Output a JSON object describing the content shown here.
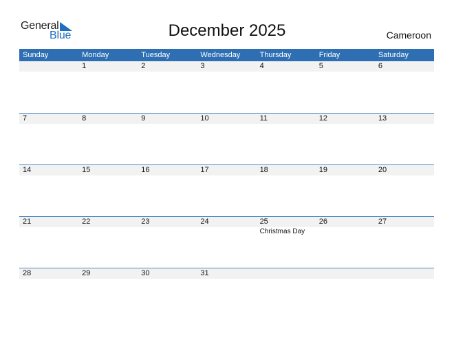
{
  "logo": {
    "general": "General",
    "blue": "Blue",
    "accent_color": "#1f6fc0"
  },
  "title": "December 2025",
  "country": "Cameroon",
  "header_color": "#2e6fb4",
  "weekdays": [
    "Sunday",
    "Monday",
    "Tuesday",
    "Wednesday",
    "Thursday",
    "Friday",
    "Saturday"
  ],
  "weeks": [
    {
      "days": [
        {
          "num": "",
          "event": ""
        },
        {
          "num": "1",
          "event": ""
        },
        {
          "num": "2",
          "event": ""
        },
        {
          "num": "3",
          "event": ""
        },
        {
          "num": "4",
          "event": ""
        },
        {
          "num": "5",
          "event": ""
        },
        {
          "num": "6",
          "event": ""
        }
      ]
    },
    {
      "days": [
        {
          "num": "7",
          "event": ""
        },
        {
          "num": "8",
          "event": ""
        },
        {
          "num": "9",
          "event": ""
        },
        {
          "num": "10",
          "event": ""
        },
        {
          "num": "11",
          "event": ""
        },
        {
          "num": "12",
          "event": ""
        },
        {
          "num": "13",
          "event": ""
        }
      ]
    },
    {
      "days": [
        {
          "num": "14",
          "event": ""
        },
        {
          "num": "15",
          "event": ""
        },
        {
          "num": "16",
          "event": ""
        },
        {
          "num": "17",
          "event": ""
        },
        {
          "num": "18",
          "event": ""
        },
        {
          "num": "19",
          "event": ""
        },
        {
          "num": "20",
          "event": ""
        }
      ]
    },
    {
      "days": [
        {
          "num": "21",
          "event": ""
        },
        {
          "num": "22",
          "event": ""
        },
        {
          "num": "23",
          "event": ""
        },
        {
          "num": "24",
          "event": ""
        },
        {
          "num": "25",
          "event": "Christmas Day"
        },
        {
          "num": "26",
          "event": ""
        },
        {
          "num": "27",
          "event": ""
        }
      ]
    },
    {
      "days": [
        {
          "num": "28",
          "event": ""
        },
        {
          "num": "29",
          "event": ""
        },
        {
          "num": "30",
          "event": ""
        },
        {
          "num": "31",
          "event": ""
        },
        {
          "num": "",
          "event": ""
        },
        {
          "num": "",
          "event": ""
        },
        {
          "num": "",
          "event": ""
        }
      ]
    }
  ]
}
